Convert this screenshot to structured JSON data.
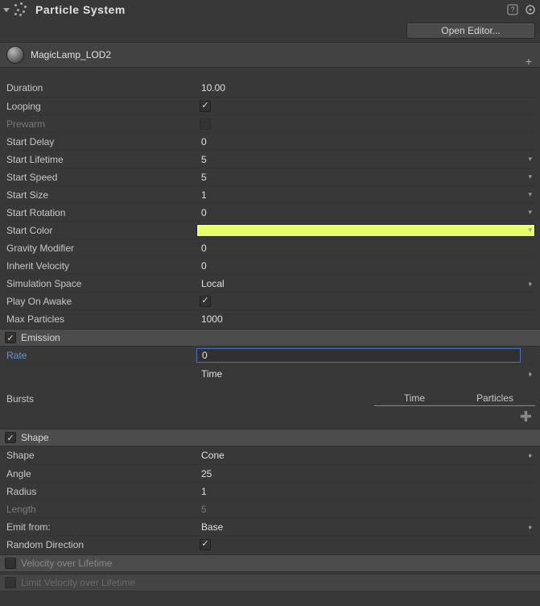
{
  "header": {
    "title": "Particle System",
    "open_editor_label": "Open Editor..."
  },
  "object": {
    "name": "MagicLamp_LOD2"
  },
  "main": {
    "duration_label": "Duration",
    "duration": "10.00",
    "looping_label": "Looping",
    "prewarm_label": "Prewarm",
    "start_delay_label": "Start Delay",
    "start_delay": "0",
    "start_lifetime_label": "Start Lifetime",
    "start_lifetime": "5",
    "start_speed_label": "Start Speed",
    "start_speed": "5",
    "start_size_label": "Start Size",
    "start_size": "1",
    "start_rotation_label": "Start Rotation",
    "start_rotation": "0",
    "start_color_label": "Start Color",
    "start_color": "#e8ff6e",
    "gravity_label": "Gravity Modifier",
    "gravity": "0",
    "inherit_vel_label": "Inherit Velocity",
    "inherit_vel": "0",
    "sim_space_label": "Simulation Space",
    "sim_space": "Local",
    "play_awake_label": "Play On Awake",
    "max_particles_label": "Max Particles",
    "max_particles": "1000"
  },
  "emission": {
    "title": "Emission",
    "rate_label": "Rate",
    "rate": "0",
    "rate_mode": "Time",
    "bursts_label": "Bursts",
    "col_time": "Time",
    "col_particles": "Particles"
  },
  "shape": {
    "title": "Shape",
    "shape_label": "Shape",
    "shape": "Cone",
    "angle_label": "Angle",
    "angle": "25",
    "radius_label": "Radius",
    "radius": "1",
    "length_label": "Length",
    "length": "5",
    "emit_from_label": "Emit from:",
    "emit_from": "Base",
    "random_dir_label": "Random Direction"
  },
  "modules": {
    "velocity_over_lifetime": "Velocity over Lifetime",
    "limit_velocity_over_lifetime": "Limit Velocity over Lifetime"
  }
}
